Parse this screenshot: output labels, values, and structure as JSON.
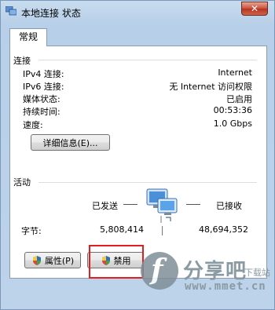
{
  "window": {
    "title": "本地连接 状态",
    "close_label": "✕"
  },
  "tab": {
    "label": "常规"
  },
  "connection": {
    "heading": "连接",
    "rows": [
      {
        "label": "IPv4 连接:",
        "value": "Internet"
      },
      {
        "label": "IPv6 连接:",
        "value": "无 Internet 访问权限"
      },
      {
        "label": "媒体状态:",
        "value": "已启用"
      },
      {
        "label": "持续时间:",
        "value": "00:53:36"
      },
      {
        "label": "速度:",
        "value": "1.0 Gbps"
      }
    ],
    "details_button": "详细信息(E)..."
  },
  "activity": {
    "heading": "活动",
    "sent_label": "已发送",
    "received_label": "已接收",
    "bytes_label": "字节:",
    "bytes_sent": "5,808,414",
    "bytes_received": "48,694,352"
  },
  "buttons": {
    "properties": "属性(P)",
    "disable": "禁用"
  },
  "watermark": {
    "logo_letter": "f",
    "title": "分享吧",
    "subtitle": "下载站",
    "url": "www.mmet.cn"
  },
  "colors": {
    "highlight": "#e02020",
    "close_button": "#c7503a"
  },
  "icons": [
    "network-icon",
    "close-icon",
    "shield-icon",
    "computers-network-icon"
  ]
}
